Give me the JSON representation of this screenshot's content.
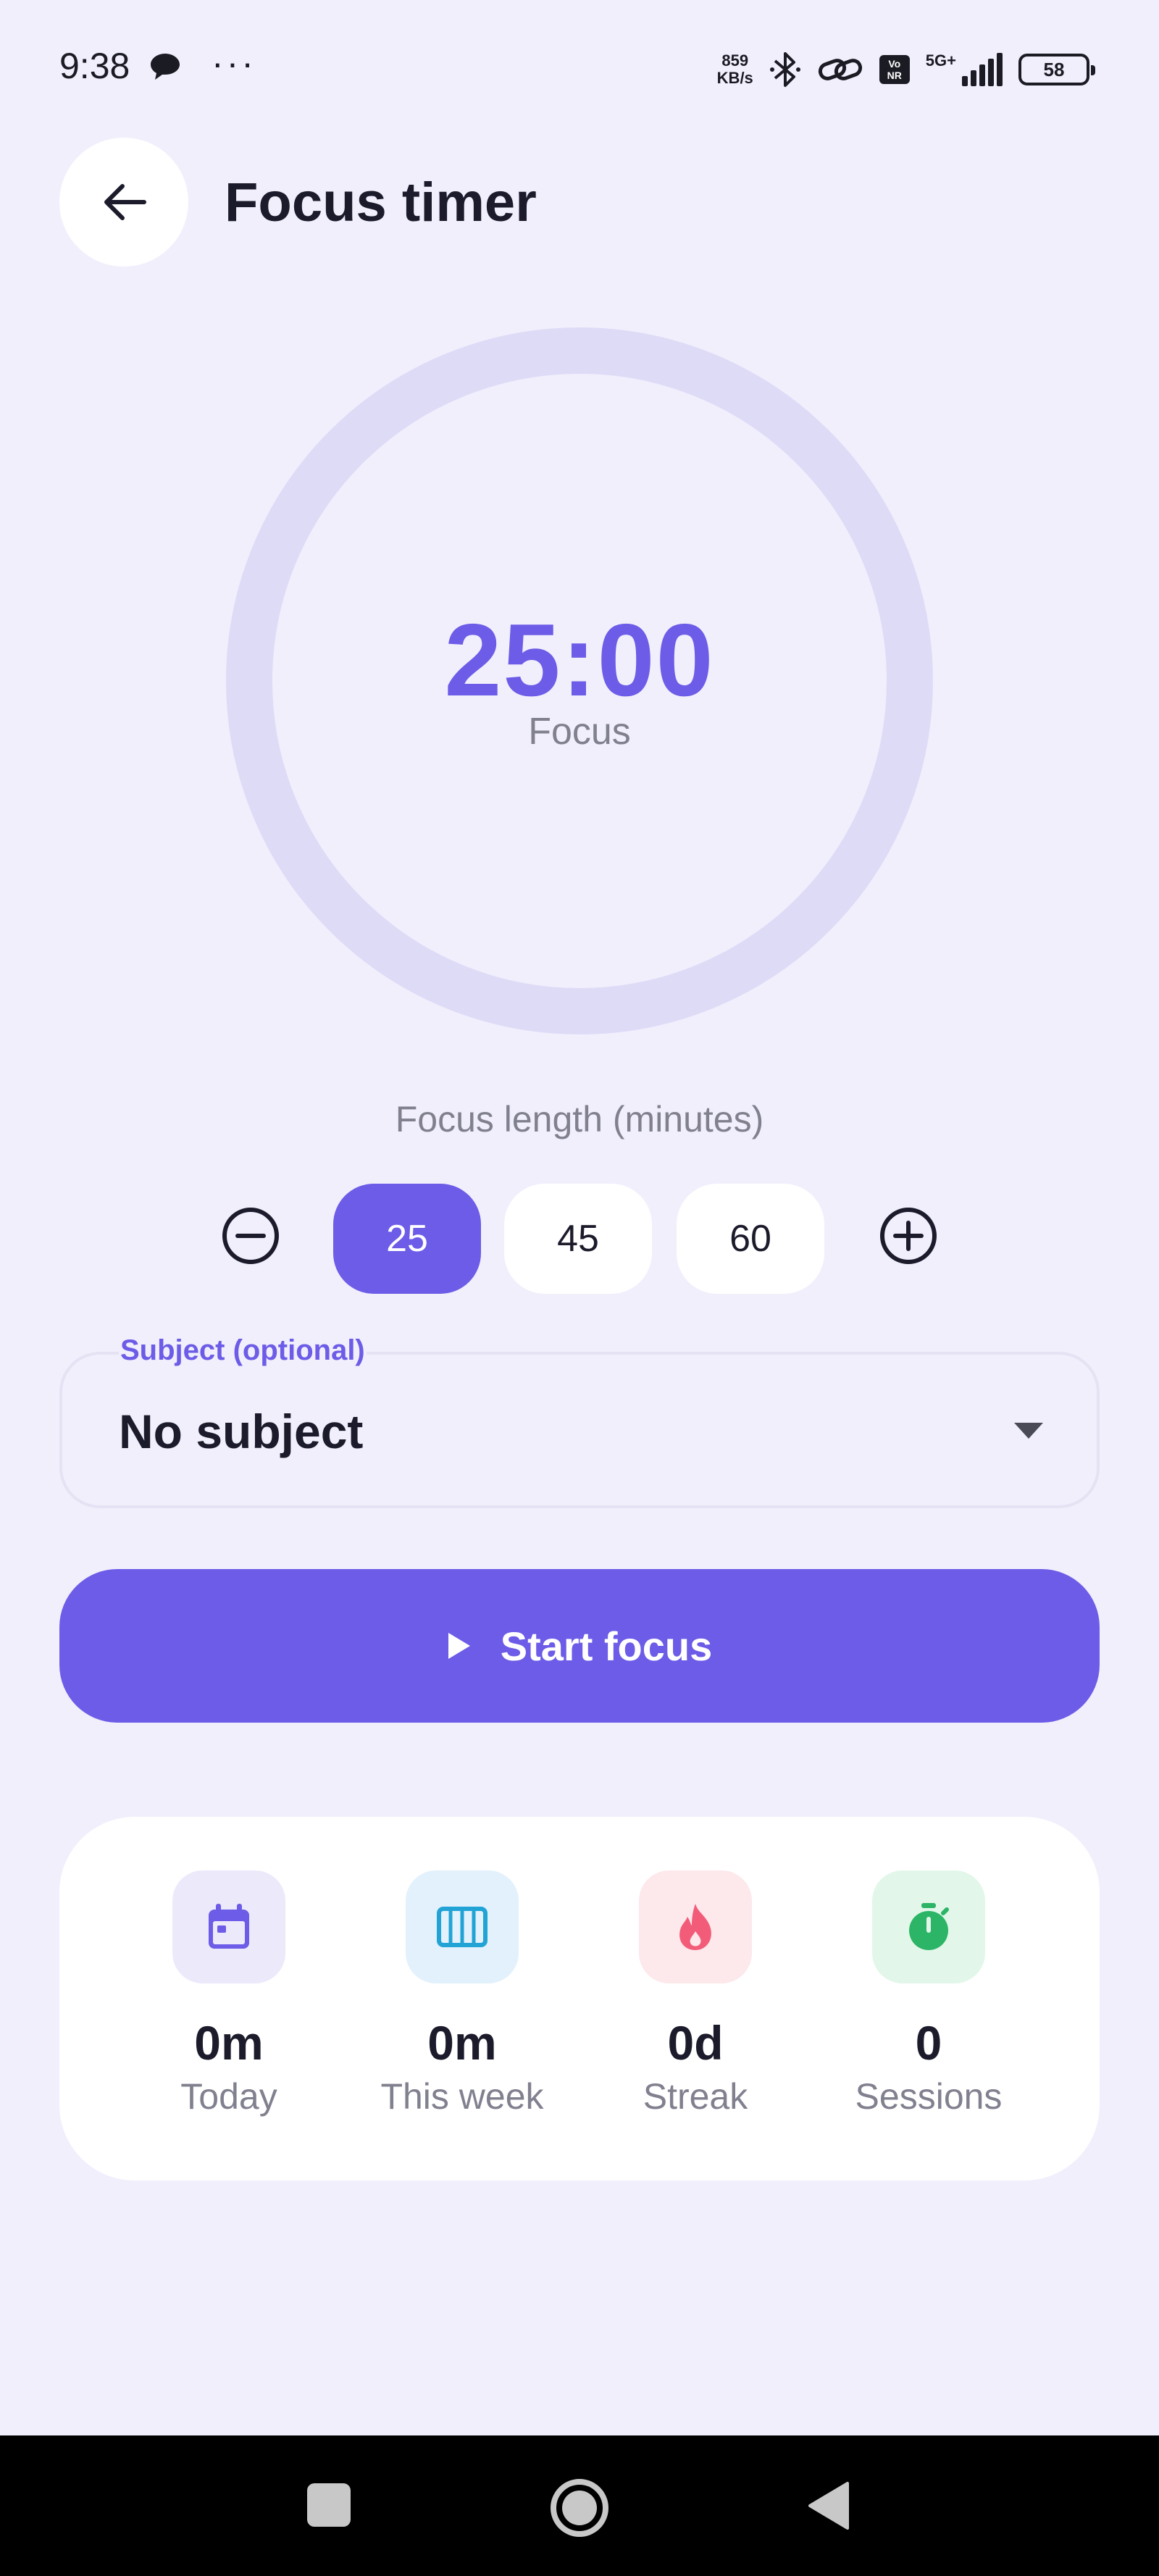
{
  "status_bar": {
    "time": "9:38",
    "dots": "···",
    "net_speed_value": "859",
    "net_speed_unit": "KB/s",
    "network_type": "5G+",
    "volte_top": "Vo",
    "volte_bottom": "NR",
    "battery": "58"
  },
  "header": {
    "title": "Focus timer"
  },
  "timer": {
    "time": "25:00",
    "mode": "Focus",
    "progress": 0
  },
  "focus_length": {
    "label": "Focus length (minutes)",
    "presets": [
      "25",
      "45",
      "60"
    ],
    "selected": "25"
  },
  "subject": {
    "label": "Subject (optional)",
    "value": "No subject"
  },
  "start_button": {
    "label": "Start focus"
  },
  "stats": [
    {
      "value": "0m",
      "label": "Today",
      "icon": "calendar-icon",
      "icon_color": "#6c5ce7",
      "bg": "#ece9fb"
    },
    {
      "value": "0m",
      "label": "This week",
      "icon": "week-columns-icon",
      "icon_color": "#22a3d6",
      "bg": "#e2f1fb"
    },
    {
      "value": "0d",
      "label": "Streak",
      "icon": "fire-icon",
      "icon_color": "#f25c78",
      "bg": "#fde8ec"
    },
    {
      "value": "0",
      "label": "Sessions",
      "icon": "stopwatch-icon",
      "icon_color": "#2cb566",
      "bg": "#e2f7ea"
    }
  ],
  "colors": {
    "accent": "#6c5ce7",
    "ring_track": "#dedbf7",
    "background": "#f1effc"
  }
}
